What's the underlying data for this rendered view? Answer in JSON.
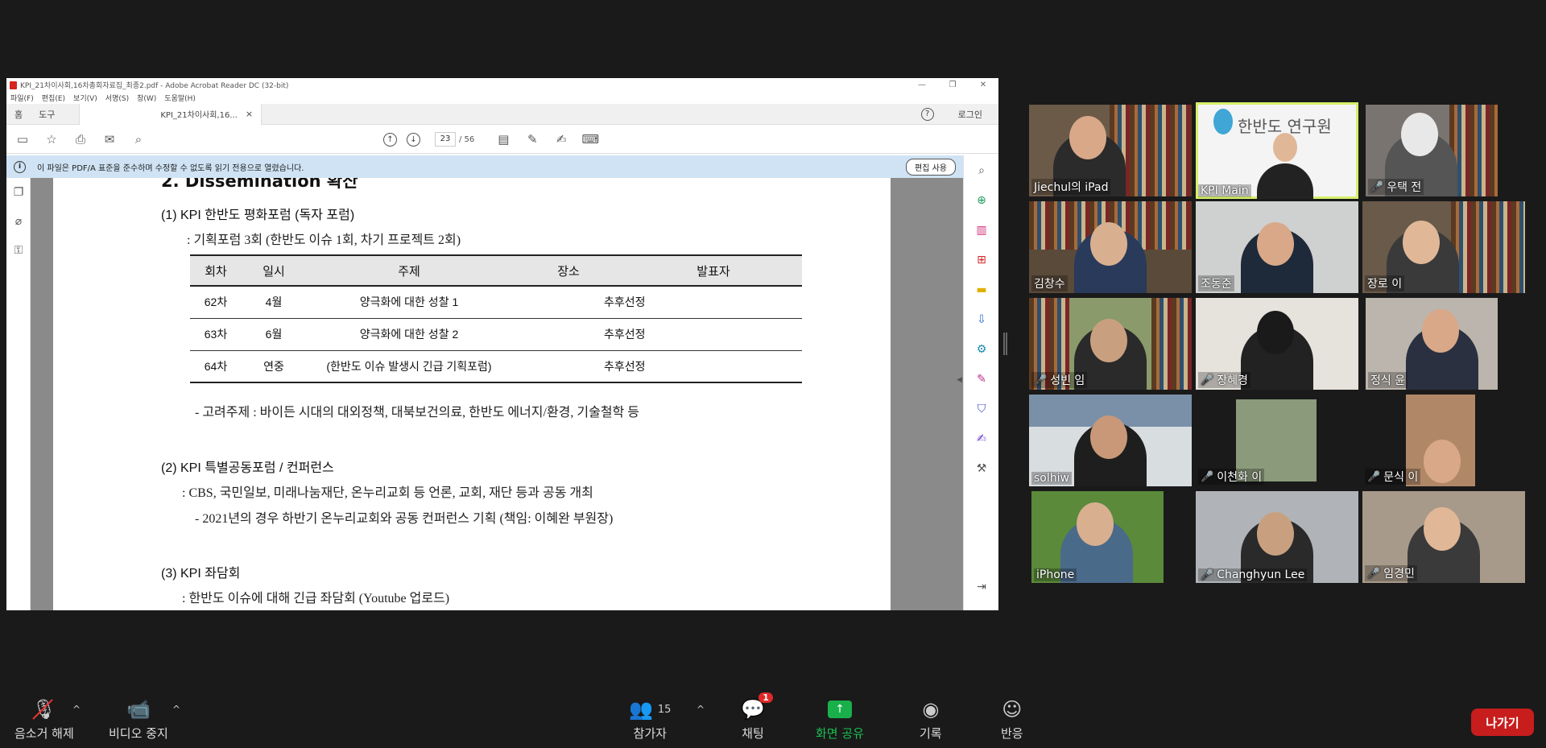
{
  "acrobat": {
    "title": "KPI_21차이사회,16차총회자료집_최종2.pdf - Adobe Acrobat Reader DC (32-bit)",
    "window_controls": [
      "—",
      "❐",
      "✕"
    ],
    "menu": [
      "파일(F)",
      "편집(E)",
      "보기(V)",
      "서명(S)",
      "창(W)",
      "도움말(H)"
    ],
    "tabs": {
      "home": "홈",
      "tools": "도구",
      "doc": "KPI_21차이사회,16...",
      "close": "×",
      "help": "?",
      "login": "로그인"
    },
    "page_current": "23",
    "page_total": "/ 56",
    "info_message": "이 파일은 PDF/A 표준을 준수하며 수정할 수 없도록 읽기 전용으로 열렸습니다.",
    "edit_button": "편집 사용"
  },
  "document": {
    "heading": "2. Dissemination 확산",
    "sec1_title": "(1) KPI 한반도 평화포럼 (독자 포럼)",
    "sec1_sub": ": 기획포럼 3회 (한반도 이슈 1회, 차기 프로젝트 2회)",
    "table": {
      "headers": [
        "회차",
        "일시",
        "주제",
        "장소",
        "발표자"
      ],
      "rows": [
        [
          "62차",
          "4월",
          "양극화에 대한 성찰 1",
          "",
          "추후선정"
        ],
        [
          "63차",
          "6월",
          "양극화에 대한 성찰 2",
          "",
          "추후선정"
        ],
        [
          "64차",
          "연중",
          "(한반도 이슈 발생시 긴급 기획포럼)",
          "",
          "추후선정"
        ]
      ]
    },
    "sec1_note": "- 고려주제 : 바이든 시대의 대외정책, 대북보건의료, 한반도 에너지/환경, 기술철학 등",
    "sec2_title": "(2) KPI 특별공동포럼 / 컨퍼런스",
    "sec2_sub": ": CBS, 국민일보, 미래나눔재단, 온누리교회 등 언론, 교회, 재단 등과 공동 개최",
    "sec2_note": "- 2021년의 경우 하반기 온누리교회와 공동 컨퍼런스 기획 (책임: 이혜완 부원장)",
    "sec3_title": "(3) KPI 좌담회",
    "sec3_sub": ": 한반도 이슈에 대해 긴급 좌담회 (Youtube 업로드)"
  },
  "participants": [
    {
      "name": "Jiechul의 iPad",
      "muted": false
    },
    {
      "name": "KPI Main",
      "muted": false,
      "active": true
    },
    {
      "name": "우택 전",
      "muted": true
    },
    {
      "name": "김창수",
      "muted": false
    },
    {
      "name": "조동준",
      "muted": false
    },
    {
      "name": "장로 이",
      "muted": false
    },
    {
      "name": "성빈 임",
      "muted": true
    },
    {
      "name": "장혜경",
      "muted": true
    },
    {
      "name": "정식 윤",
      "muted": false
    },
    {
      "name": "solhiw",
      "muted": false
    },
    {
      "name": "이천화 이",
      "muted": true
    },
    {
      "name": "문식 이",
      "muted": true
    },
    {
      "name": "iPhone",
      "muted": false
    },
    {
      "name": "Changhyun Lee",
      "muted": true
    },
    {
      "name": "임경민",
      "muted": true
    }
  ],
  "kpi_logo_text": "한반도     연구원",
  "toolbar": {
    "unmute": "음소거 해제",
    "stop_video": "비디오 중지",
    "participants": "참가자",
    "participants_count": "15",
    "chat": "채팅",
    "chat_badge": "1",
    "share": "화면 공유",
    "record": "기록",
    "reactions": "반응",
    "leave": "나가기"
  },
  "colors": {
    "leave": "#c81d1d",
    "share": "#19b04b",
    "active_speaker": "#d6ef6a",
    "info_bar": "#cfe3f4"
  }
}
